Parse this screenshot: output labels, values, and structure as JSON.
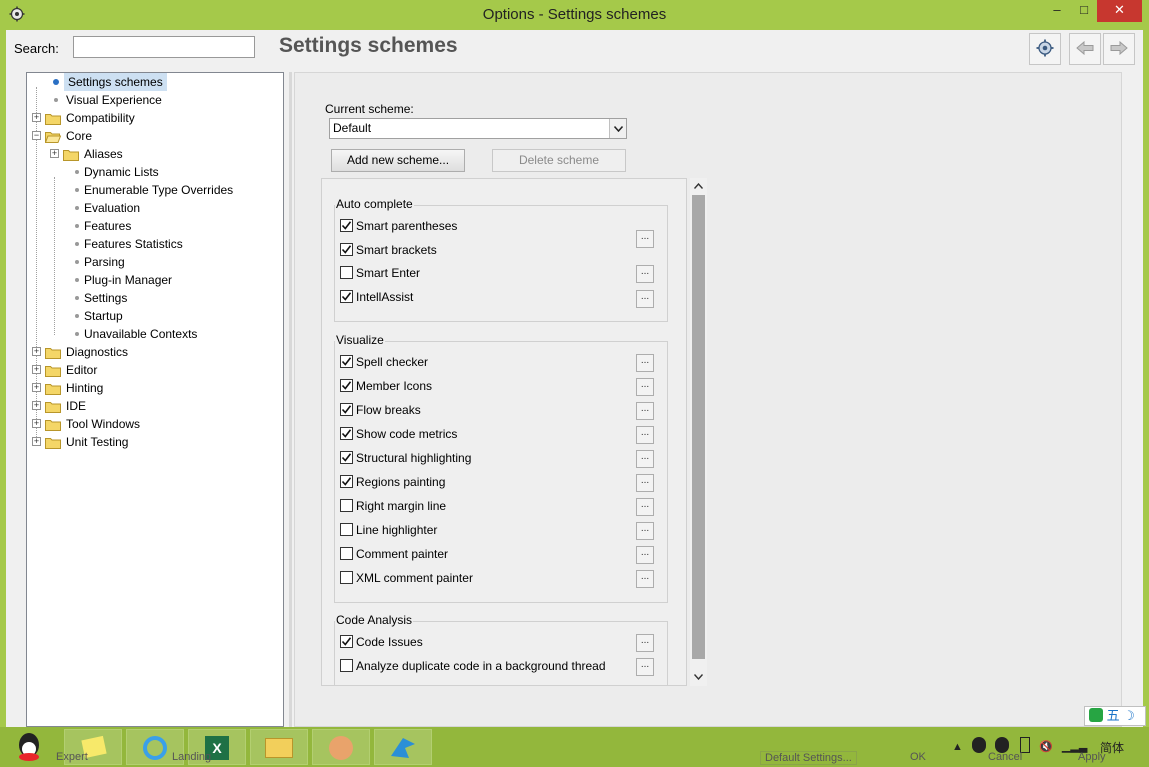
{
  "window": {
    "title": "Options - Settings schemes",
    "min_glyph": "–",
    "max_glyph": "□",
    "close_glyph": "✕"
  },
  "search": {
    "label": "Search:",
    "value": "",
    "placeholder": ""
  },
  "page_title": "Settings schemes",
  "toolbar": {
    "icons": [
      "gear-icon",
      "arrow-left-icon",
      "arrow-right-icon"
    ]
  },
  "tree": {
    "items": [
      {
        "label": "Settings schemes"
      },
      {
        "label": "Visual Experience"
      },
      {
        "label": "Compatibility"
      },
      {
        "label": "Core"
      },
      {
        "label": "Aliases"
      },
      {
        "label": "Dynamic Lists"
      },
      {
        "label": "Enumerable Type Overrides"
      },
      {
        "label": "Evaluation"
      },
      {
        "label": "Features"
      },
      {
        "label": "Features Statistics"
      },
      {
        "label": "Parsing"
      },
      {
        "label": "Plug-in Manager"
      },
      {
        "label": "Settings"
      },
      {
        "label": "Startup"
      },
      {
        "label": "Unavailable Contexts"
      },
      {
        "label": "Diagnostics"
      },
      {
        "label": "Editor"
      },
      {
        "label": "Hinting"
      },
      {
        "label": "IDE"
      },
      {
        "label": "Tool Windows"
      },
      {
        "label": "Unit Testing"
      }
    ]
  },
  "scheme": {
    "label": "Current scheme:",
    "selected": "Default",
    "add_label": "Add new scheme...",
    "delete_label": "Delete scheme"
  },
  "groups": {
    "auto_complete": {
      "title": "Auto complete",
      "options": [
        {
          "label": "Smart parentheses",
          "checked": true
        },
        {
          "label": "Smart brackets",
          "checked": true
        },
        {
          "label": "Smart Enter",
          "checked": false
        },
        {
          "label": "IntellAssist",
          "checked": true
        }
      ]
    },
    "visualize": {
      "title": "Visualize",
      "options": [
        {
          "label": "Spell checker",
          "checked": true
        },
        {
          "label": "Member Icons",
          "checked": true
        },
        {
          "label": "Flow breaks",
          "checked": true
        },
        {
          "label": "Show code metrics",
          "checked": true
        },
        {
          "label": "Structural highlighting",
          "checked": true
        },
        {
          "label": "Regions painting",
          "checked": true
        },
        {
          "label": "Right margin line",
          "checked": false
        },
        {
          "label": "Line highlighter",
          "checked": false
        },
        {
          "label": "Comment painter",
          "checked": false
        },
        {
          "label": "XML comment painter",
          "checked": false
        }
      ]
    },
    "code_analysis": {
      "title": "Code Analysis",
      "options": [
        {
          "label": "Code Issues",
          "checked": true
        },
        {
          "label": "Analyze duplicate code in a background thread",
          "checked": false
        }
      ]
    }
  },
  "dots_label": "...",
  "bottom": {
    "default_settings": "Default Settings...",
    "ok": "OK",
    "cancel": "Cancel",
    "apply": "Apply",
    "expert": "Expert",
    "landing": "Landing"
  },
  "tray": {
    "ime_label": "五",
    "lang_label": "简体"
  },
  "colors": {
    "titlebar": "#a5c94a",
    "close": "#c7372f",
    "selection": "#cde0f2"
  }
}
